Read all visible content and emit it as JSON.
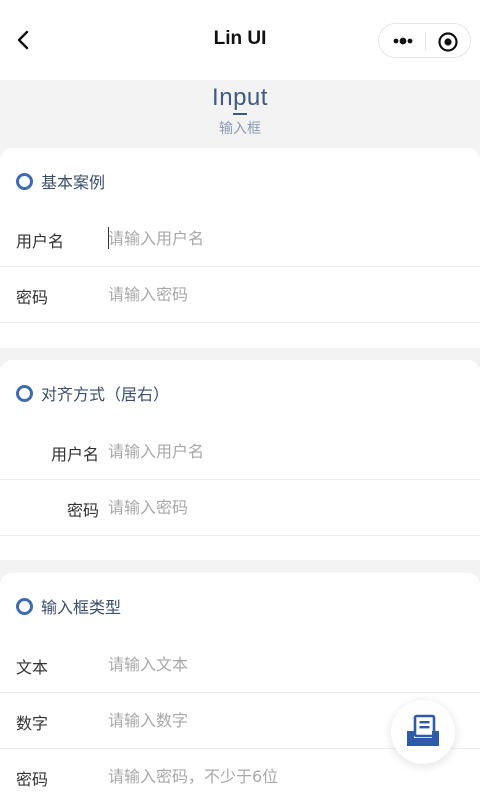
{
  "navbar": {
    "title": "Lin UI",
    "back_icon": "chevron-left-icon",
    "more_icon": "more-dots-icon",
    "close_icon": "target-circle-icon"
  },
  "page": {
    "title": "Input",
    "subtitle": "输入框"
  },
  "sections": [
    {
      "title": "基本案例",
      "rows": [
        {
          "label": "用户名",
          "placeholder": "请输入用户名"
        },
        {
          "label": "密码",
          "placeholder": "请输入密码"
        }
      ]
    },
    {
      "title": "对齐方式（居右）",
      "rows": [
        {
          "label": "用户名",
          "placeholder": "请输入用户名"
        },
        {
          "label": "密码",
          "placeholder": "请输入密码"
        }
      ]
    },
    {
      "title": "输入框类型",
      "rows": [
        {
          "label": "文本",
          "placeholder": "请输入文本"
        },
        {
          "label": "数字",
          "placeholder": "请输入数字"
        },
        {
          "label": "密码",
          "placeholder": "请输入密码，不少于6位"
        }
      ]
    }
  ],
  "fab": {
    "icon": "document-tray-icon"
  },
  "colors": {
    "accent": "#3d6cb4",
    "title": "#3d5a80"
  }
}
